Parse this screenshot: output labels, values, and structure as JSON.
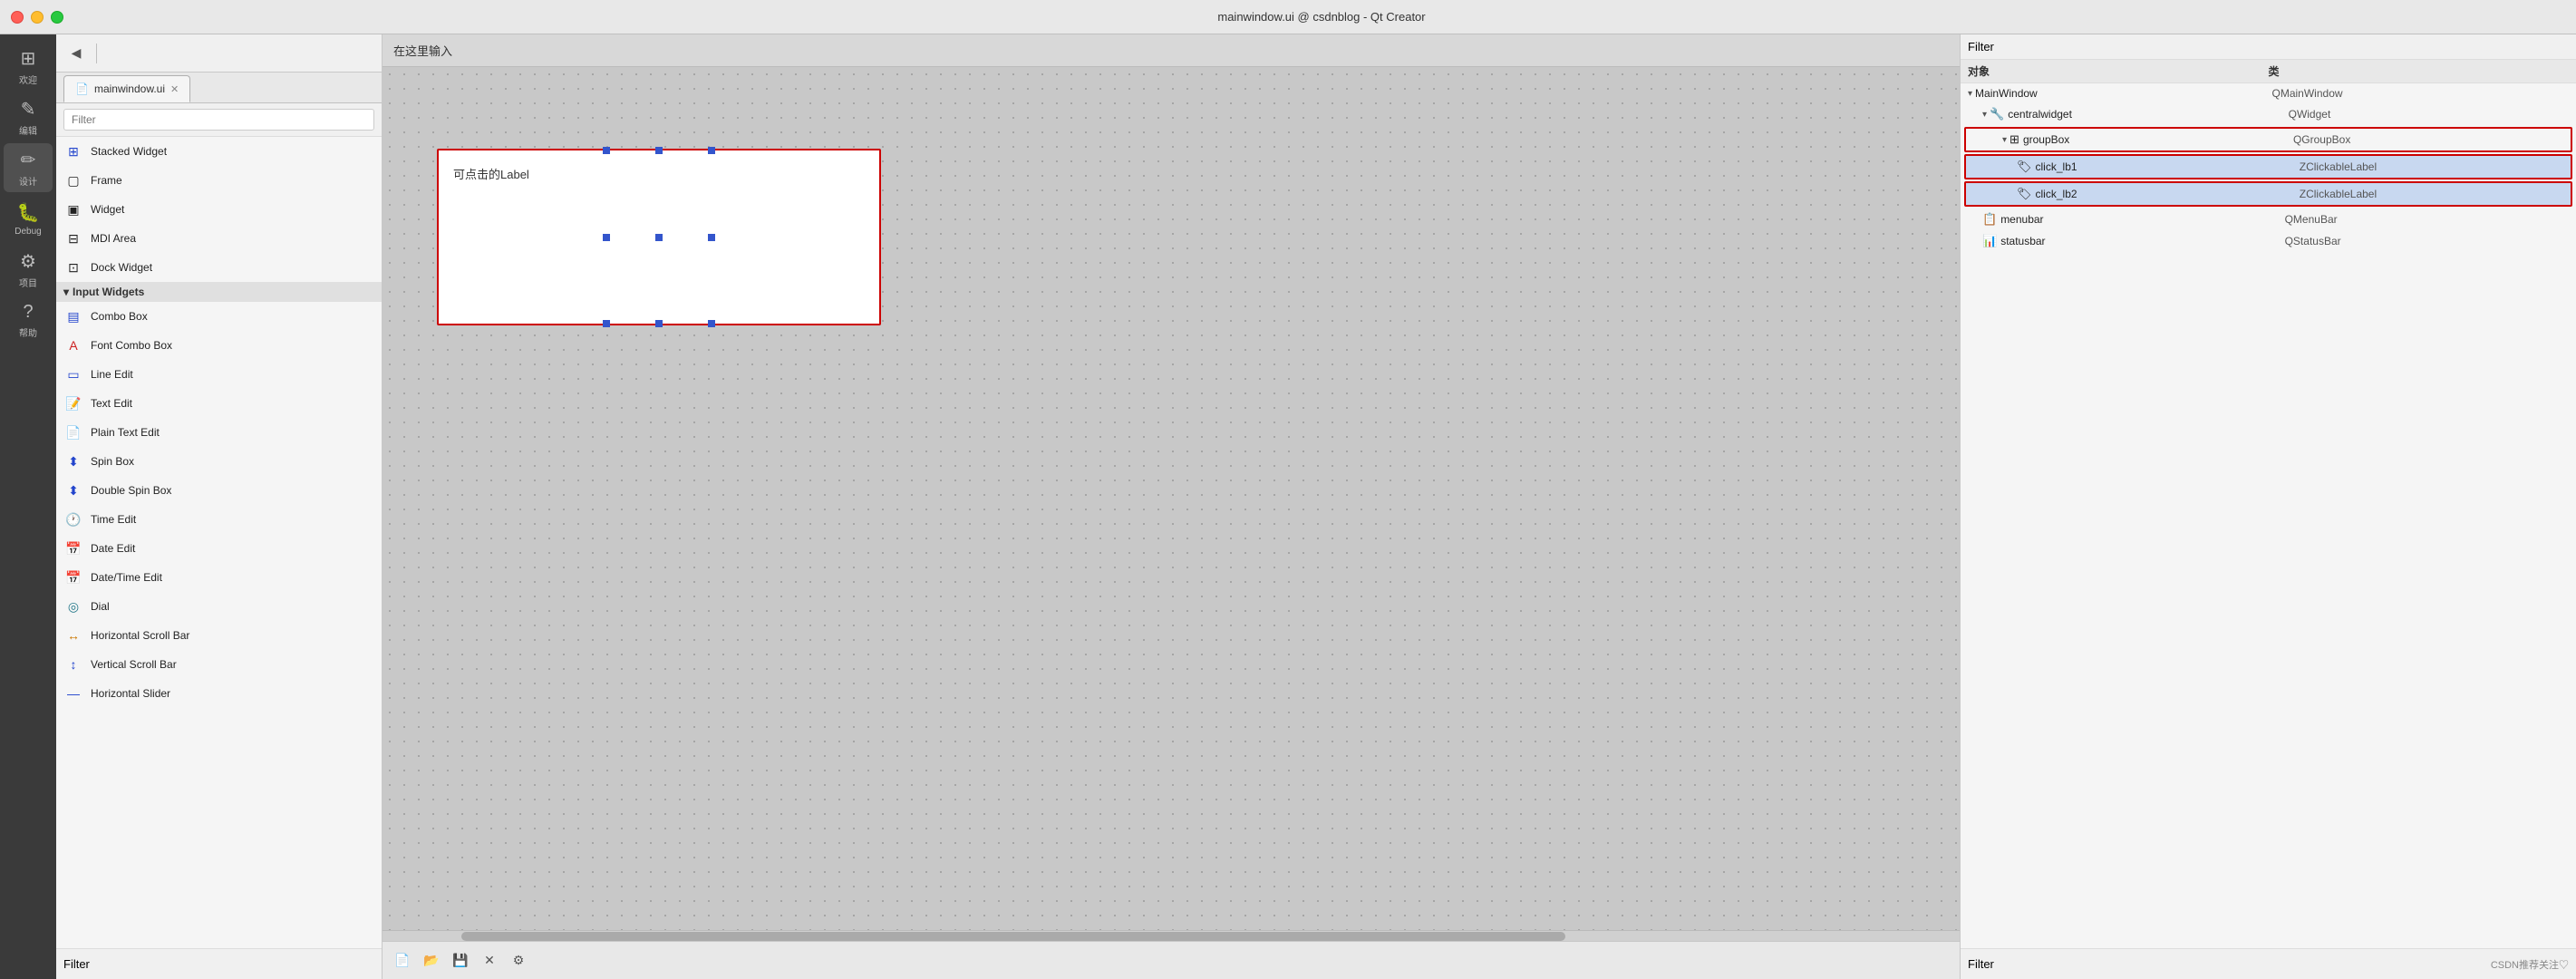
{
  "titlebar": {
    "title": "mainwindow.ui @ csdnblog - Qt Creator",
    "icon": "📄"
  },
  "toolbar": {
    "buttons": [
      "⬅",
      "⬆",
      "▼"
    ]
  },
  "tab": {
    "label": "mainwindow.ui",
    "icon": "📄"
  },
  "canvas": {
    "label": "在这里输入",
    "widget_label": "可点击的Label"
  },
  "sidebar": {
    "items": [
      {
        "label": "欢迎",
        "icon": "⊞"
      },
      {
        "label": "编辑",
        "icon": "✎"
      },
      {
        "label": "设计",
        "icon": "✏"
      },
      {
        "label": "Debug",
        "icon": "🐛"
      },
      {
        "label": "项目",
        "icon": "⚙"
      },
      {
        "label": "帮助",
        "icon": "?"
      }
    ]
  },
  "widget_list": {
    "filter_placeholder": "Filter",
    "sections": [
      {
        "id": "input-widgets",
        "label": "Input Widgets",
        "items": [
          {
            "id": "combo-box",
            "label": "Combo Box",
            "icon": "▤"
          },
          {
            "id": "font-combo-box",
            "label": "Font Combo Box",
            "icon": "A▤"
          },
          {
            "id": "line-edit",
            "label": "Line Edit",
            "icon": "▭"
          },
          {
            "id": "text-edit",
            "label": "Text Edit",
            "icon": "📝"
          },
          {
            "id": "plain-text-edit",
            "label": "Plain Text Edit",
            "icon": "📄"
          },
          {
            "id": "spin-box",
            "label": "Spin Box",
            "icon": "⬍"
          },
          {
            "id": "double-spin-box",
            "label": "Double Spin Box",
            "icon": "⬍"
          },
          {
            "id": "time-edit",
            "label": "Time Edit",
            "icon": "🕐"
          },
          {
            "id": "date-edit",
            "label": "Date Edit",
            "icon": "📅"
          },
          {
            "id": "date-time-edit",
            "label": "Date/Time Edit",
            "icon": "📅"
          },
          {
            "id": "dial",
            "label": "Dial",
            "icon": "◎"
          },
          {
            "id": "horizontal-scroll-bar",
            "label": "Horizontal Scroll Bar",
            "icon": "↔"
          },
          {
            "id": "vertical-scroll-bar",
            "label": "Vertical Scroll Bar",
            "icon": "↕"
          },
          {
            "id": "horizontal-slider",
            "label": "Horizontal Slider",
            "icon": "—●—"
          }
        ]
      }
    ],
    "above_input": [
      {
        "id": "stacked-widget",
        "label": "Stacked Widget",
        "icon": "⊞"
      },
      {
        "id": "frame",
        "label": "Frame",
        "icon": "▢"
      },
      {
        "id": "widget",
        "label": "Widget",
        "icon": "▣"
      },
      {
        "id": "mdi-area",
        "label": "MDI Area",
        "icon": "⊟"
      },
      {
        "id": "dock-widget",
        "label": "Dock Widget",
        "icon": "⊡"
      }
    ]
  },
  "right_panel": {
    "filter_label": "Filter",
    "col_obj": "对象",
    "col_cls": "类",
    "tree": [
      {
        "id": "mainwindow",
        "label": "MainWindow",
        "cls": "QMainWindow",
        "level": 0,
        "expanded": true,
        "children": [
          {
            "id": "centralwidget",
            "label": "centralwidget",
            "cls": "QWidget",
            "level": 1,
            "expanded": true,
            "children": [
              {
                "id": "groupbox",
                "label": "groupBox",
                "cls": "QGroupBox",
                "level": 2,
                "expanded": true,
                "highlighted": true,
                "children": [
                  {
                    "id": "click_lb1",
                    "label": "click_lb1",
                    "cls": "ZClickableLabel",
                    "level": 3,
                    "selected": true
                  },
                  {
                    "id": "click_lb2",
                    "label": "click_lb2",
                    "cls": "ZClickableLabel",
                    "level": 3,
                    "selected": true
                  }
                ]
              }
            ]
          },
          {
            "id": "menubar",
            "label": "menubar",
            "cls": "QMenuBar",
            "level": 1
          },
          {
            "id": "statusbar",
            "label": "statusbar",
            "cls": "QStatusBar",
            "level": 1
          }
        ]
      }
    ]
  },
  "bottom": {
    "filter_label": "Filter",
    "right_filter_label": "Filter",
    "status_text": "CSDN推荐关注♡"
  }
}
